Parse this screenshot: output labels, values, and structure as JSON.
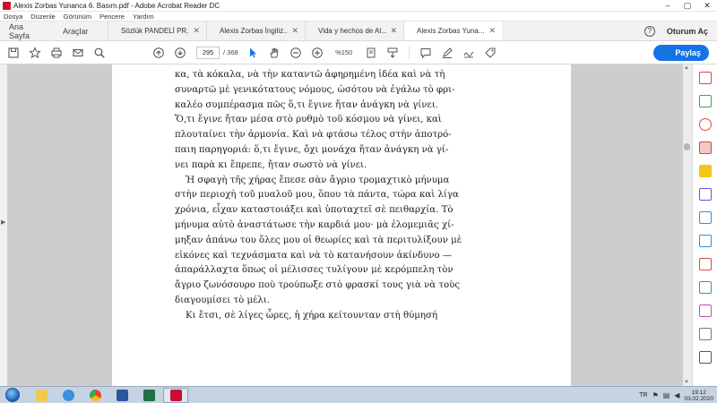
{
  "window": {
    "title": "Alexis Zorbas Yunanca 6. Basım.pdf - Adobe Acrobat Reader DC",
    "minimize": "–",
    "maximize": "▢",
    "close": "✕"
  },
  "menu": [
    "Dosya",
    "Düzenle",
    "Görünüm",
    "Pencere",
    "Yardım"
  ],
  "tabs": {
    "home": "Ana Sayfa",
    "tools": "Araçlar",
    "docs": [
      {
        "label": "Sözlük PANDELİ PR...",
        "active": false
      },
      {
        "label": "Alexis Zorbas İngiliz...",
        "active": false
      },
      {
        "label": "Vida y hechos de Al...",
        "active": false
      },
      {
        "label": "Alexis Zorbas Yuna...",
        "active": true
      }
    ],
    "help": "?",
    "signin": "Oturum Aç"
  },
  "toolbar": {
    "current_page": "295",
    "page_total": "/ 368",
    "zoom": "%150",
    "share": "Paylaş"
  },
  "document": {
    "lines": [
      "κα, τὰ κόκαλα, νὰ τὴν καταντῶ ἀφηρημένη ἰδέα καὶ νὰ τὴ",
      "συναρτῶ μὲ γενικότατους νόμους, ὡσότου νὰ ἐγάλω τὸ φρι-",
      "καλέο συμπέρασμα πῶς ὅ,τι ἔγινε ἤταν ἀνάγκη νὰ γίνει.",
      "Ὅ,τι ἔγινε ἤταν μέσα στὸ ρυθμὸ τοῦ κόσμου νὰ γίνει, καὶ",
      "πλουταίνει τὴν ἀρμονία. Καὶ νὰ φτάσω τέλος στὴν ἀποτρό-",
      "παιη παρηγοριά: ὅ,τι ἔγινε, ὄχι μονάχα ἤταν ἀνάγκη νὰ γί-",
      "νει παρὰ κι ἔπρεπε, ἤταν σωστὸ νὰ γίνει.",
      "Ἡ σφαγὴ τῆς χήρας ἔπεσε σὰν ἄγριο τρομαχτικὸ μήνυμα",
      "στὴν περιοχὴ τοῦ μυαλοῦ μου, ὅπου τὰ πάντα, τώρα καὶ λίγα",
      "χρόνια, εἶχαν καταστοιάξει καὶ ὑποταχτεῖ σὲ πειθαρχία. Τὸ",
      "μήνυμα αὐτὸ ἀναστάτωσε τὴν καρδιά μου· μὰ ἐλομεμιᾶς χί-",
      "μηξαν ἀπάνω του ὅλες μου οἱ θεωρίες καὶ τὰ περιτυλίξουν μὲ",
      "εἰκόνες καὶ τεχνάσματα καὶ νὰ τὸ κατανήσουν ἀκίνδυνο —",
      "ἀπαράλλαχτα ὅπως οἱ μέλισσες τυλίγουν μὲ κερόμπελη τὸν",
      "ἄγριο ζωνόσουρο ποὺ τρούπωξε στὸ φρασκί τους γιὰ νὰ τοὺς",
      "διαγουμίσει τὸ μέλι.",
      "Κι ἔτσι, σὲ λίγες ὧρες, ἡ χήρα κείτουνταν στὴ θύμησή"
    ],
    "page_number": "295"
  },
  "taskbar": {
    "lang": "TR",
    "time": "19:12",
    "date": "03.02.2020"
  },
  "colors": {
    "accent": "#1473e6",
    "viewer_bg": "#cdcdcd",
    "taskbar": "#c6d3e2"
  }
}
